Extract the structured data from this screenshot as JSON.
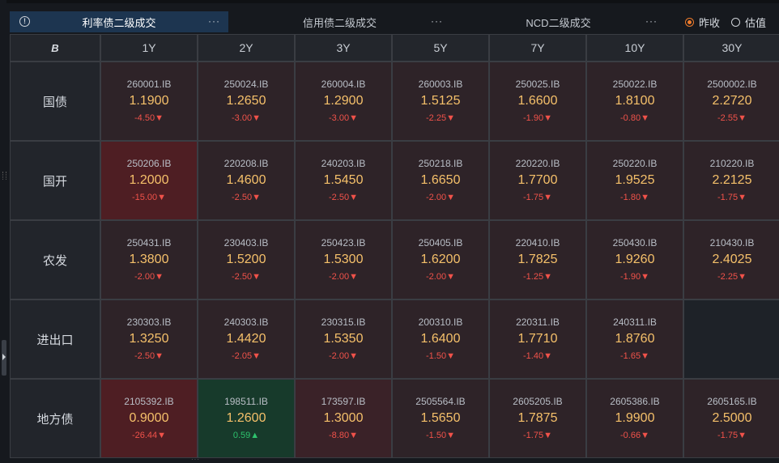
{
  "tabs": [
    {
      "label": "利率债二级成交",
      "active": true
    },
    {
      "label": "信用债二级成交",
      "active": false
    },
    {
      "label": "NCD二级成交",
      "active": false
    }
  ],
  "more_label": "···",
  "radio_options": [
    {
      "label": "昨收",
      "checked": true
    },
    {
      "label": "估值",
      "checked": false
    }
  ],
  "header": {
    "corner_logo": "B",
    "tenors": [
      "1Y",
      "2Y",
      "3Y",
      "5Y",
      "7Y",
      "10Y",
      "30Y"
    ]
  },
  "rows": [
    {
      "label": "国债",
      "cells": [
        {
          "code": "260001.IB",
          "rate": "1.1900",
          "change": "-4.50▼",
          "dir": "down"
        },
        {
          "code": "250024.IB",
          "rate": "1.2650",
          "change": "-3.00▼",
          "dir": "down"
        },
        {
          "code": "260004.IB",
          "rate": "1.2900",
          "change": "-3.00▼",
          "dir": "down"
        },
        {
          "code": "260003.IB",
          "rate": "1.5125",
          "change": "-2.25▼",
          "dir": "down"
        },
        {
          "code": "250025.IB",
          "rate": "1.6600",
          "change": "-1.90▼",
          "dir": "down"
        },
        {
          "code": "250022.IB",
          "rate": "1.8100",
          "change": "-0.80▼",
          "dir": "down"
        },
        {
          "code": "2500002.IB",
          "rate": "2.2720",
          "change": "-2.55▼",
          "dir": "down"
        }
      ]
    },
    {
      "label": "国开",
      "cells": [
        {
          "code": "250206.IB",
          "rate": "1.2000",
          "change": "-15.00▼",
          "dir": "down-strong"
        },
        {
          "code": "220208.IB",
          "rate": "1.4600",
          "change": "-2.50▼",
          "dir": "down"
        },
        {
          "code": "240203.IB",
          "rate": "1.5450",
          "change": "-2.50▼",
          "dir": "down"
        },
        {
          "code": "250218.IB",
          "rate": "1.6650",
          "change": "-2.00▼",
          "dir": "down"
        },
        {
          "code": "220220.IB",
          "rate": "1.7700",
          "change": "-1.75▼",
          "dir": "down"
        },
        {
          "code": "250220.IB",
          "rate": "1.9525",
          "change": "-1.80▼",
          "dir": "down"
        },
        {
          "code": "210220.IB",
          "rate": "2.2125",
          "change": "-1.75▼",
          "dir": "down"
        }
      ]
    },
    {
      "label": "农发",
      "cells": [
        {
          "code": "250431.IB",
          "rate": "1.3800",
          "change": "-2.00▼",
          "dir": "down"
        },
        {
          "code": "230403.IB",
          "rate": "1.5200",
          "change": "-2.50▼",
          "dir": "down"
        },
        {
          "code": "250423.IB",
          "rate": "1.5300",
          "change": "-2.00▼",
          "dir": "down"
        },
        {
          "code": "250405.IB",
          "rate": "1.6200",
          "change": "-2.00▼",
          "dir": "down"
        },
        {
          "code": "220410.IB",
          "rate": "1.7825",
          "change": "-1.25▼",
          "dir": "down"
        },
        {
          "code": "250430.IB",
          "rate": "1.9260",
          "change": "-1.90▼",
          "dir": "down"
        },
        {
          "code": "210430.IB",
          "rate": "2.4025",
          "change": "-2.25▼",
          "dir": "down"
        }
      ]
    },
    {
      "label": "进出口",
      "cells": [
        {
          "code": "230303.IB",
          "rate": "1.3250",
          "change": "-2.50▼",
          "dir": "down"
        },
        {
          "code": "240303.IB",
          "rate": "1.4420",
          "change": "-2.05▼",
          "dir": "down"
        },
        {
          "code": "230315.IB",
          "rate": "1.5350",
          "change": "-2.00▼",
          "dir": "down"
        },
        {
          "code": "200310.IB",
          "rate": "1.6400",
          "change": "-1.50▼",
          "dir": "down"
        },
        {
          "code": "220311.IB",
          "rate": "1.7710",
          "change": "-1.40▼",
          "dir": "down"
        },
        {
          "code": "240311.IB",
          "rate": "1.8760",
          "change": "-1.65▼",
          "dir": "down"
        },
        {
          "code": "",
          "rate": "",
          "change": "",
          "dir": "empty"
        }
      ]
    },
    {
      "label": "地方债",
      "cells": [
        {
          "code": "2105392.IB",
          "rate": "0.9000",
          "change": "-26.44▼",
          "dir": "down-strong"
        },
        {
          "code": "198511.IB",
          "rate": "1.2600",
          "change": "0.59▲",
          "dir": "up"
        },
        {
          "code": "173597.IB",
          "rate": "1.3000",
          "change": "-8.80▼",
          "dir": "down-mid"
        },
        {
          "code": "2505564.IB",
          "rate": "1.5650",
          "change": "-1.50▼",
          "dir": "down"
        },
        {
          "code": "2605205.IB",
          "rate": "1.7875",
          "change": "-1.75▼",
          "dir": "down"
        },
        {
          "code": "2605386.IB",
          "rate": "1.9900",
          "change": "-0.66▼",
          "dir": "down"
        },
        {
          "code": "2605165.IB",
          "rate": "2.5000",
          "change": "-1.75▼",
          "dir": "down"
        }
      ]
    }
  ],
  "colors": {
    "down": "#2e2328",
    "down-mid": "#3a2228",
    "down-strong": "#4e1e23",
    "up": "#173a2b",
    "empty": "#1e2228",
    "rate": "#f5c06a",
    "change_down": "#f0524a",
    "change_up": "#2ec26d",
    "accent": "#f07c2c"
  }
}
